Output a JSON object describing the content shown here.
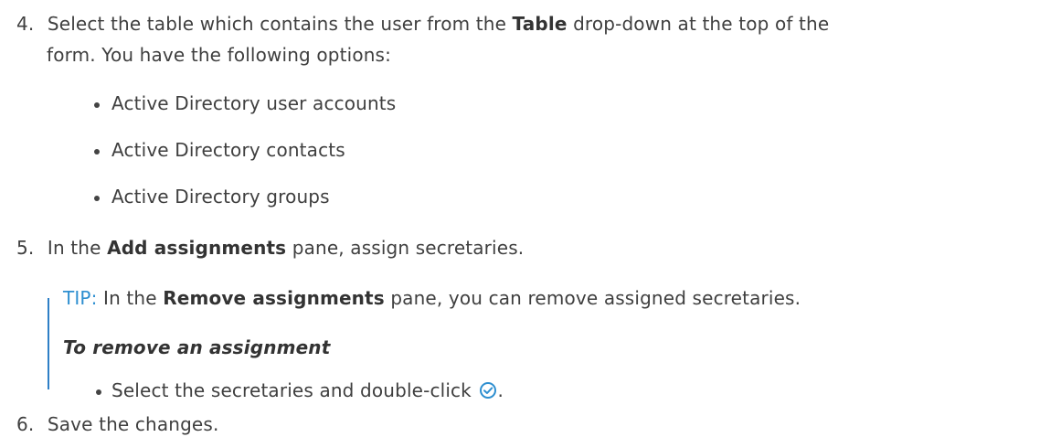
{
  "step4": {
    "number": "4.",
    "line1_pre": "Select the table which contains the user from the ",
    "line1_bold": "Table",
    "line1_post": " drop-down at the top of the",
    "line2": "form. You have the following options:",
    "options": [
      "Active Directory user accounts",
      "Active Directory contacts",
      "Active Directory groups"
    ]
  },
  "step5": {
    "number": "5.",
    "pre": "In the ",
    "bold": "Add assignments",
    "post": " pane, assign secretaries."
  },
  "tip": {
    "label": "TIP:",
    "pre": " In the ",
    "bold": "Remove assignments",
    "post": " pane, you can remove assigned secretaries.",
    "heading": "To remove an assignment",
    "bullet": "Select the secretaries and double-click",
    "bullet_end": ".",
    "icon": "check-circle-icon",
    "accent_color": "#2e8fd0"
  },
  "step6": {
    "number": "6.",
    "text": "Save the changes."
  }
}
